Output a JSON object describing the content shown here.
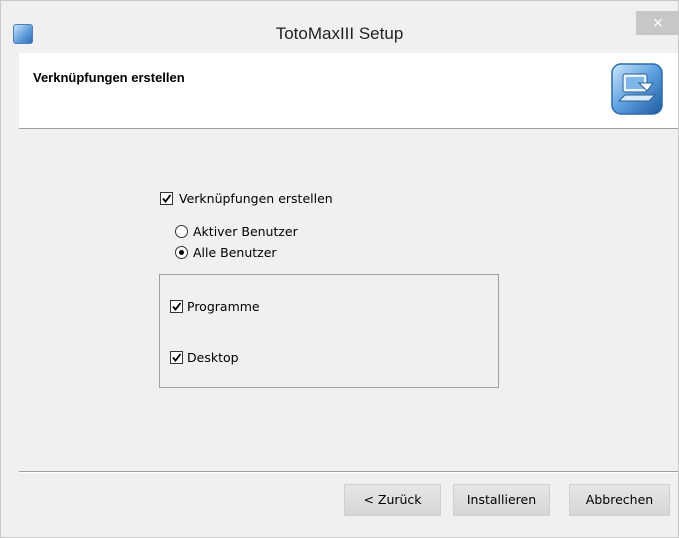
{
  "window": {
    "title": "TotoMaxIII Setup",
    "close_glyph": "×"
  },
  "header": {
    "title": "Verknüpfungen erstellen",
    "icon": "setup-computer-icon"
  },
  "options": {
    "create_shortcuts": {
      "label": "Verknüpfungen erstellen",
      "checked": true
    },
    "scope": {
      "current_user": {
        "label": "Aktiver Benutzer",
        "selected": false
      },
      "all_users": {
        "label": "Alle Benutzer",
        "selected": true
      }
    },
    "locations": {
      "programs": {
        "label": "Programme",
        "checked": true
      },
      "desktop": {
        "label": "Desktop",
        "checked": true
      }
    }
  },
  "buttons": {
    "back": "< Zurück",
    "install": "Installieren",
    "cancel": "Abbrechen"
  }
}
